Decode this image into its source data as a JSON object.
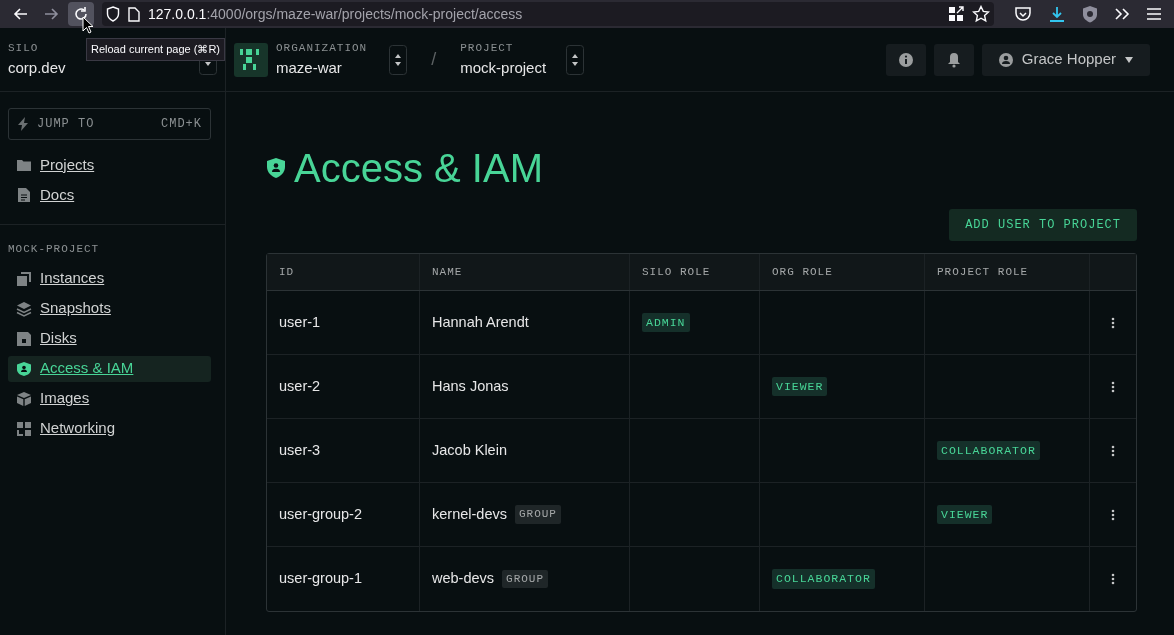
{
  "browser": {
    "url_host": "127.0.0.1",
    "url_path": ":4000/orgs/maze-war/projects/mock-project/access",
    "tooltip": "Reload current page (⌘R)"
  },
  "header": {
    "silo": {
      "label": "SILO",
      "value": "corp.dev"
    },
    "organization": {
      "label": "ORGANIZATION",
      "value": "maze-war"
    },
    "separator": "/",
    "project": {
      "label": "PROJECT",
      "value": "mock-project"
    },
    "user": "Grace Hopper"
  },
  "sidebar": {
    "jump": {
      "label": "JUMP TO",
      "shortcut": "CMD+K"
    },
    "top_items": [
      {
        "label": "Projects",
        "selected": false
      },
      {
        "label": "Docs",
        "selected": false
      }
    ],
    "section_title": "MOCK-PROJECT",
    "items": [
      {
        "label": "Instances",
        "selected": false
      },
      {
        "label": "Snapshots",
        "selected": false
      },
      {
        "label": "Disks",
        "selected": false
      },
      {
        "label": "Access & IAM",
        "selected": true
      },
      {
        "label": "Images",
        "selected": false
      },
      {
        "label": "Networking",
        "selected": false
      }
    ]
  },
  "page": {
    "title": "Access & IAM",
    "add_button": "ADD USER TO PROJECT",
    "table": {
      "columns": [
        "ID",
        "NAME",
        "SILO ROLE",
        "ORG ROLE",
        "PROJECT ROLE"
      ],
      "rows": [
        {
          "id": "user-1",
          "name": "Hannah Arendt",
          "silo_role": "ADMIN"
        },
        {
          "id": "user-2",
          "name": "Hans Jonas",
          "org_role": "VIEWER"
        },
        {
          "id": "user-3",
          "name": "Jacob Klein",
          "project_role": "COLLABORATOR"
        },
        {
          "id": "user-group-2",
          "name": "kernel-devs",
          "tag": "GROUP",
          "project_role": "VIEWER"
        },
        {
          "id": "user-group-1",
          "name": "web-devs",
          "tag": "GROUP",
          "org_role": "COLLABORATOR"
        }
      ]
    }
  }
}
